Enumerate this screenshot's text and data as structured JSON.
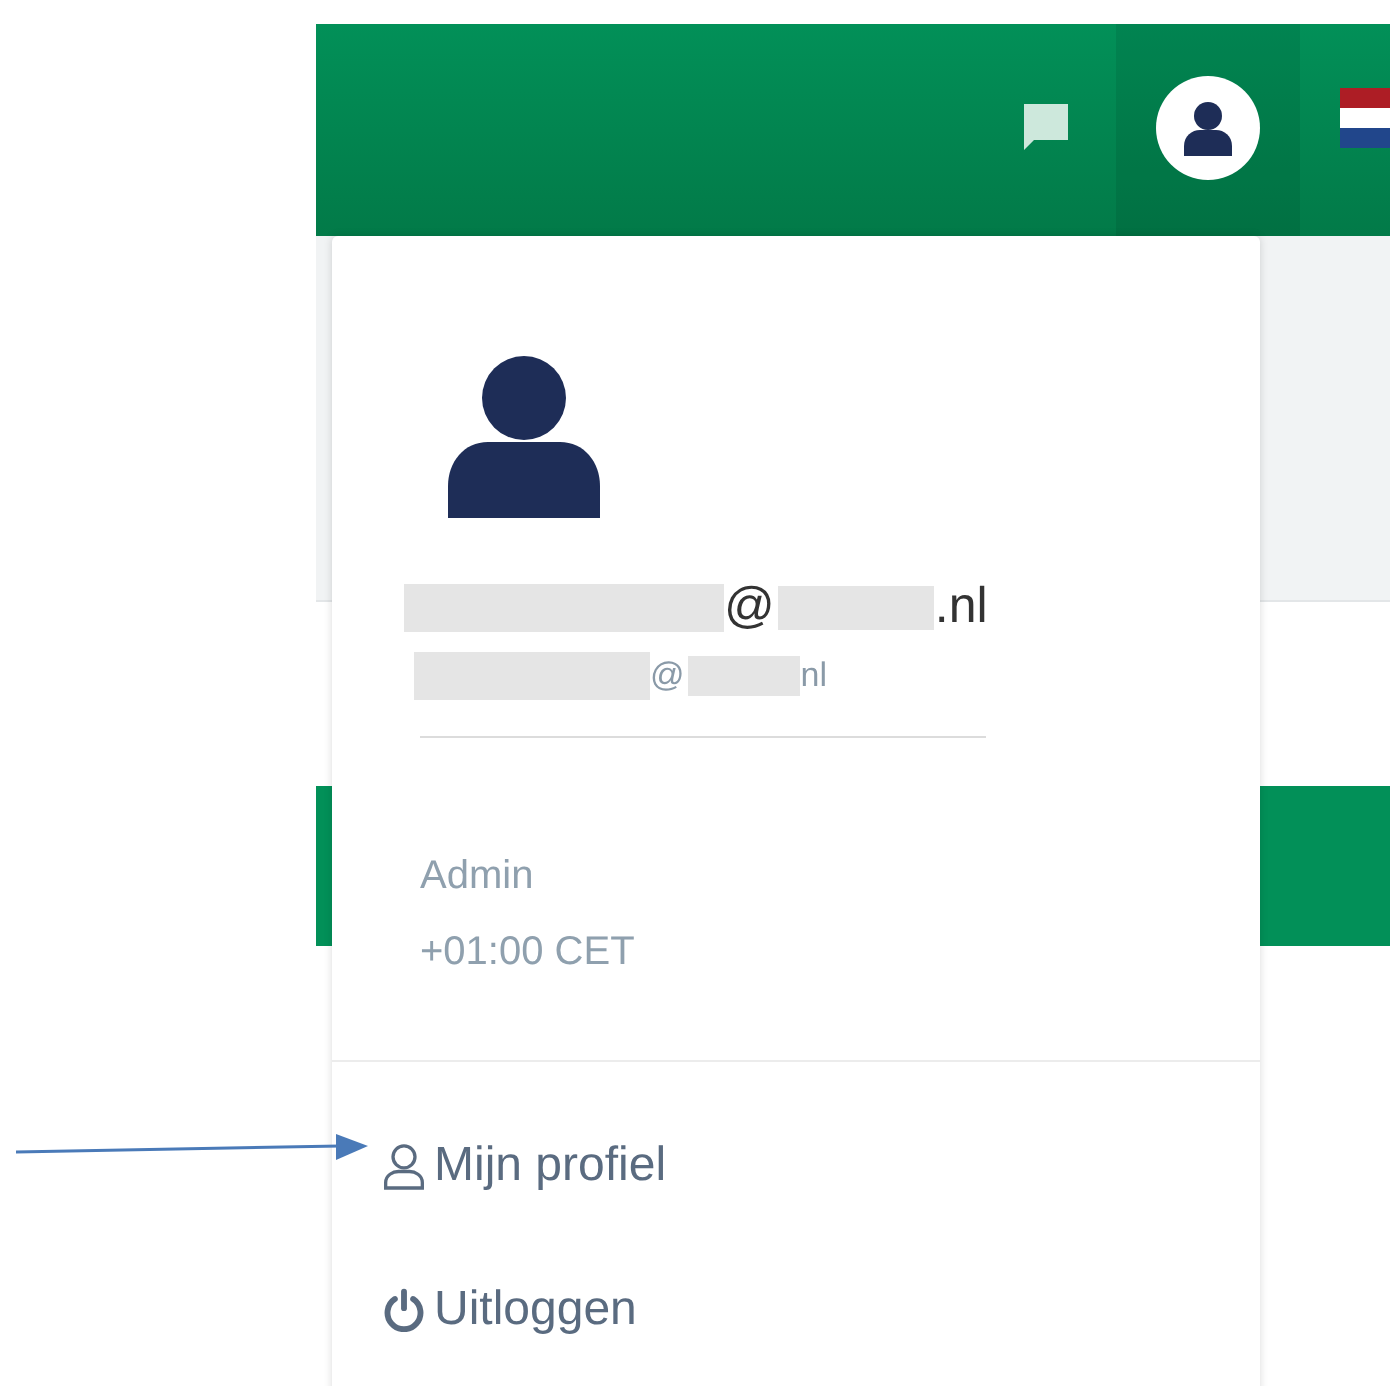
{
  "header": {
    "user_button": {
      "selected": true
    }
  },
  "user_menu": {
    "email_lines": [
      [
        {
          "kind": "redacted"
        },
        {
          "kind": "text",
          "text": "@"
        },
        {
          "kind": "redacted"
        },
        {
          "kind": "text",
          "text": ".nl"
        }
      ],
      [
        {
          "kind": "redacted"
        },
        {
          "kind": "text",
          "text": "@"
        },
        {
          "kind": "redacted"
        },
        {
          "kind": "text",
          "text": "nl"
        }
      ]
    ],
    "role": "Admin",
    "timezone": "+01:00 CET",
    "items": [
      {
        "kind": "profile",
        "label": "Mijn profiel"
      },
      {
        "kind": "logout",
        "label": "Uitloggen"
      }
    ]
  },
  "annotations": [
    {
      "kind": "arrow"
    }
  ]
}
